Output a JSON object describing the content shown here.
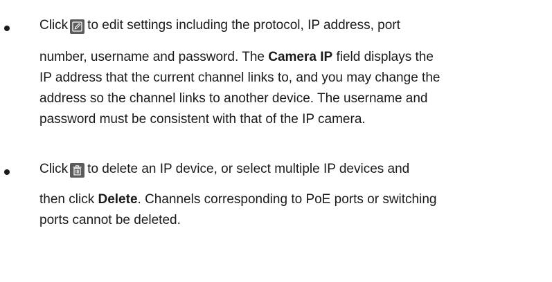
{
  "items": [
    {
      "icon": "edit-icon",
      "lines": [
        {
          "before": "Click",
          "after": "to edit settings including the protocol, IP address, port"
        },
        {
          "pre": "number, username and password. The ",
          "bold": "Camera IP",
          "post": " field displays the"
        },
        {
          "text": "IP address that the current channel links to, and you may change the"
        },
        {
          "text": "address so the channel links to another device. The username and"
        },
        {
          "text": "password must be consistent with that of the IP camera."
        }
      ]
    },
    {
      "icon": "trash-icon",
      "lines": [
        {
          "before": "Click",
          "after": "to delete an IP device, or select multiple IP devices and"
        },
        {
          "pre": "then click ",
          "bold": "Delete",
          "post": ". Channels corresponding to PoE ports or switching"
        },
        {
          "text": "ports cannot be deleted."
        }
      ]
    }
  ]
}
